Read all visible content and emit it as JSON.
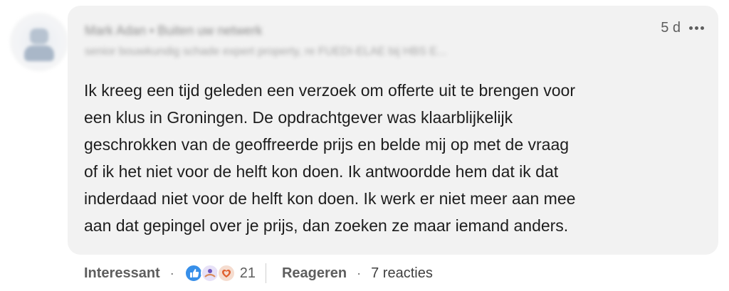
{
  "comment": {
    "author_name": "Mark Adan",
    "author_connection": "• Buiten uw netwerk",
    "author_headline": "senior bouwkundig schade expert property, re FUEDI-ELAE bij HBS E...",
    "timestamp": "5 d",
    "text": "Ik kreeg een tijd geleden een verzoek om offerte uit te brengen voor\neen klus in Groningen. De opdrachtgever was klaarblijkelijk\ngeschrokken van de geoffreerde prijs en belde mij op met de vraag\nof ik het niet voor de helft kon doen. Ik antwoordde hem dat ik dat\ninderdaad niet voor de helft kon doen. Ik werk er niet meer aan mee\naan dat gepingel over je prijs, dan zoeken ze maar iemand anders."
  },
  "actions": {
    "like_label": "Interessant",
    "separator": "·",
    "reaction_count": "21",
    "reply_label": "Reageren",
    "replies_label": "7 reacties"
  },
  "icons": {
    "reactions": [
      "like-icon",
      "support-icon",
      "love-icon"
    ],
    "more": "more-horizontal-icon"
  },
  "colors": {
    "like": "#378fe9",
    "love": "#e05f2e",
    "bubble": "#f2f2f2"
  }
}
